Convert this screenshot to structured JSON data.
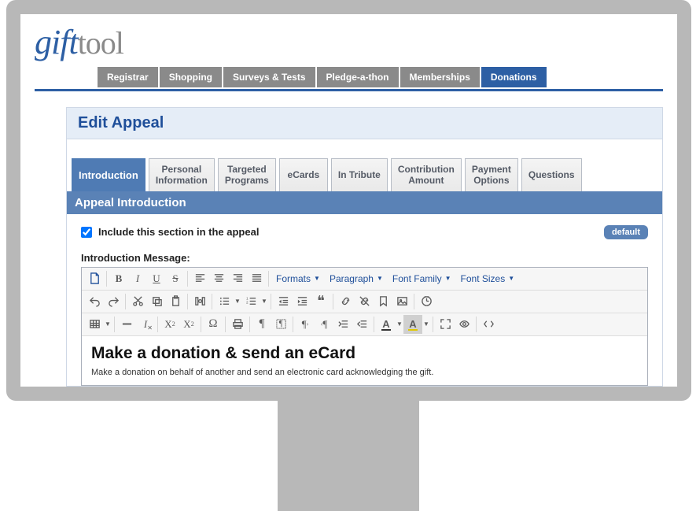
{
  "logo": {
    "left": "gift",
    "right": "tool"
  },
  "topnav": [
    {
      "label": "Registrar",
      "active": false
    },
    {
      "label": "Shopping",
      "active": false
    },
    {
      "label": "Surveys & Tests",
      "active": false
    },
    {
      "label": "Pledge-a-thon",
      "active": false
    },
    {
      "label": "Memberships",
      "active": false
    },
    {
      "label": "Donations",
      "active": true
    }
  ],
  "panel": {
    "title": "Edit Appeal",
    "section_header": "Appeal Introduction"
  },
  "tabs": [
    {
      "label": "Introduction",
      "active": true
    },
    {
      "label": "Personal\nInformation",
      "active": false
    },
    {
      "label": "Targeted\nPrograms",
      "active": false
    },
    {
      "label": "eCards",
      "active": false
    },
    {
      "label": "In Tribute",
      "active": false
    },
    {
      "label": "Contribution\nAmount",
      "active": false
    },
    {
      "label": "Payment\nOptions",
      "active": false
    },
    {
      "label": "Questions",
      "active": false
    }
  ],
  "form": {
    "include_checked": true,
    "include_label": "Include this section in the appeal",
    "default_btn": "default",
    "intro_label": "Introduction Message:"
  },
  "dropdowns": {
    "formats": "Formats",
    "paragraph": "Paragraph",
    "font_family": "Font Family",
    "font_sizes": "Font Sizes"
  },
  "editor": {
    "heading": "Make a donation & send an eCard",
    "body": "Make a donation on behalf of another and send an electronic card acknowledging the gift."
  },
  "icons": {
    "new_document": "new-document-icon",
    "bold": "B",
    "italic": "I",
    "underline": "U",
    "strike": "S",
    "undo": "undo",
    "redo": "redo"
  }
}
